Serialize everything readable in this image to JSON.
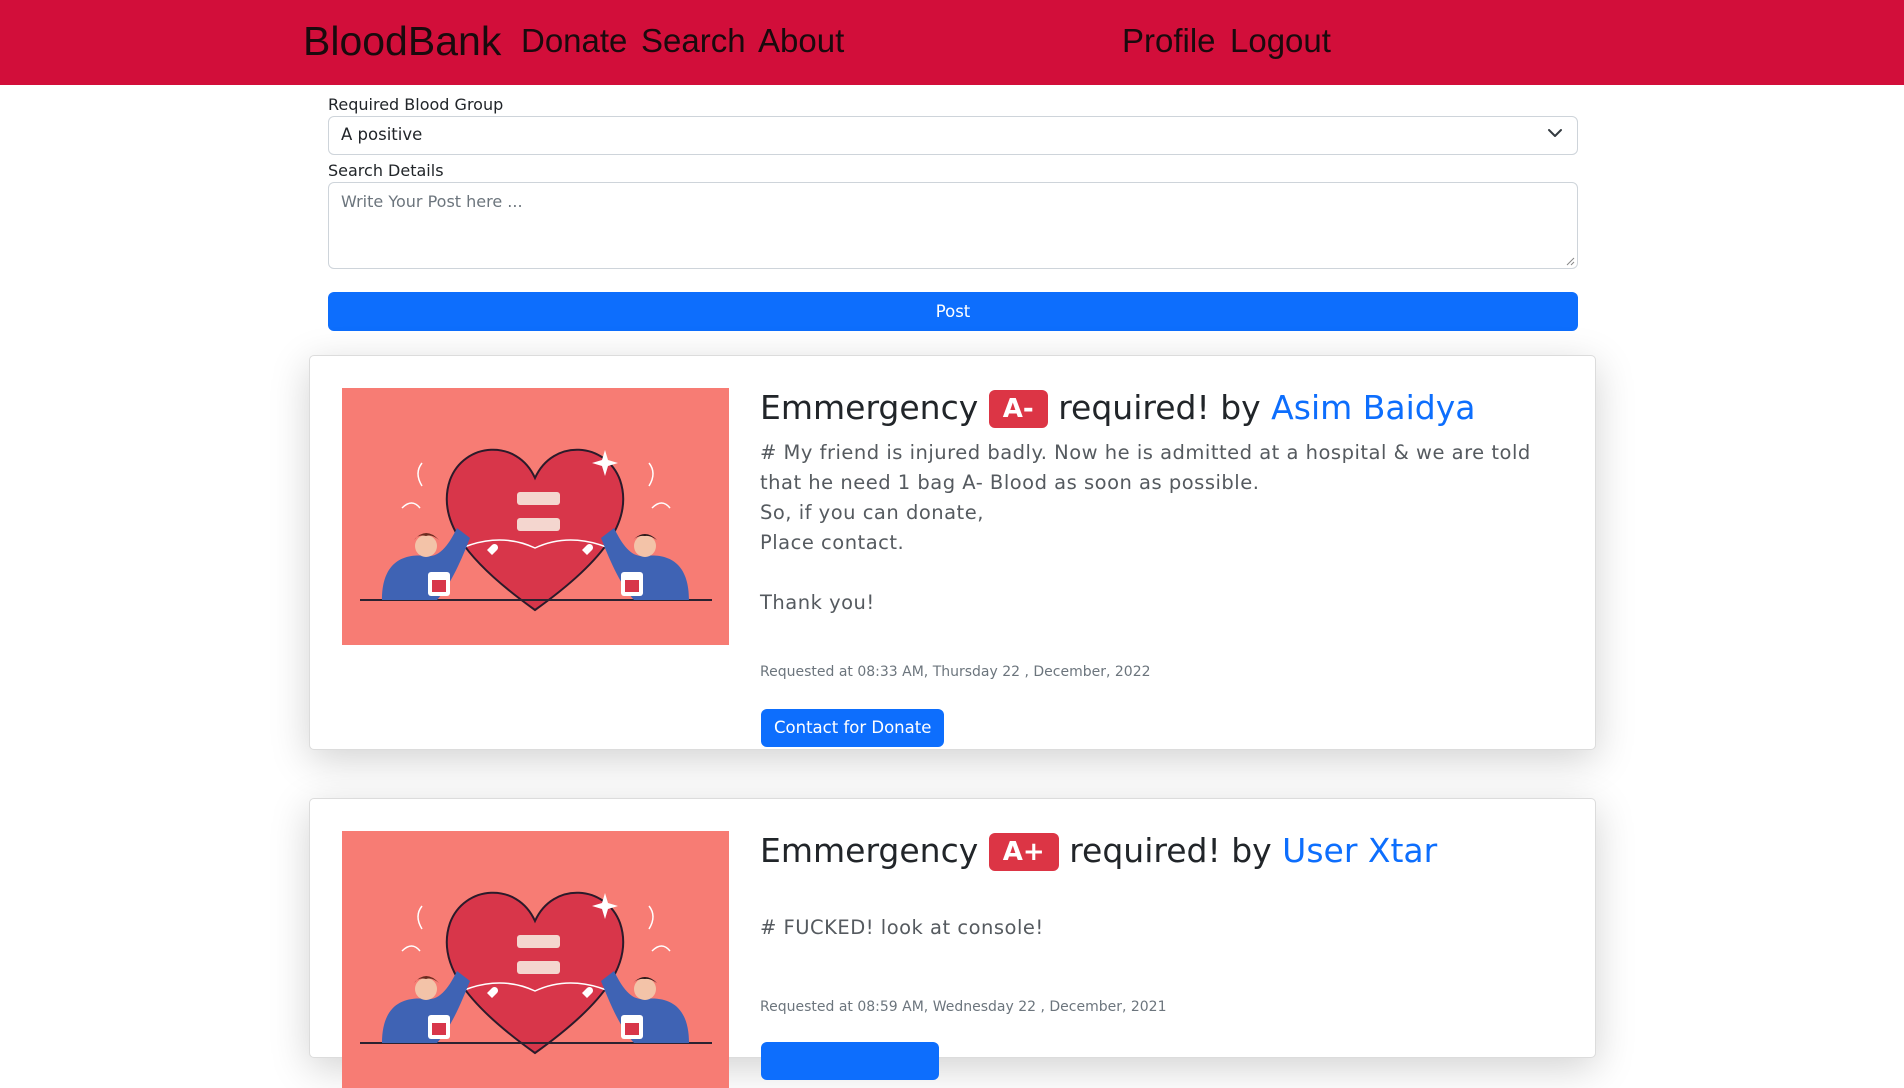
{
  "nav": {
    "brand": "BloodBank",
    "links": [
      "Donate",
      "Search",
      "About"
    ],
    "right_links": [
      "Profile",
      "Logout"
    ],
    "color": "#d20e3a"
  },
  "form": {
    "blood_group_label": "Required Blood Group",
    "blood_group_value": "A positive",
    "details_label": "Search Details",
    "details_placeholder": "Write Your Post here ...",
    "post_button": "Post"
  },
  "posts": [
    {
      "prefix": "Emmergency",
      "blood_group": "A-",
      "middle": "required! by",
      "author": "Asim Baidya",
      "text": "# My friend is injured badly. Now he is admitted at a hospital & we are told that he need 1 bag A- Blood as soon as possible.\nSo, if you can donate,\nPlace contact.\n\nThank you!",
      "requested": "Requested at 08:33 AM, Thursday 22 , December, 2022",
      "button": "Contact for Donate",
      "image_icon": "heart-donation-illustration"
    },
    {
      "prefix": "Emmergency",
      "blood_group": "A+",
      "middle": "required! by",
      "author": "User Xtar",
      "text": "# FUCKED! look at console!",
      "requested": "Requested at 08:59 AM, Wednesday 22 , December, 2021",
      "button": "",
      "image_icon": "heart-donation-illustration"
    }
  ],
  "colors": {
    "badge": "#dc3545",
    "primary": "#0d6efd",
    "image_bg": "#f77c74"
  }
}
